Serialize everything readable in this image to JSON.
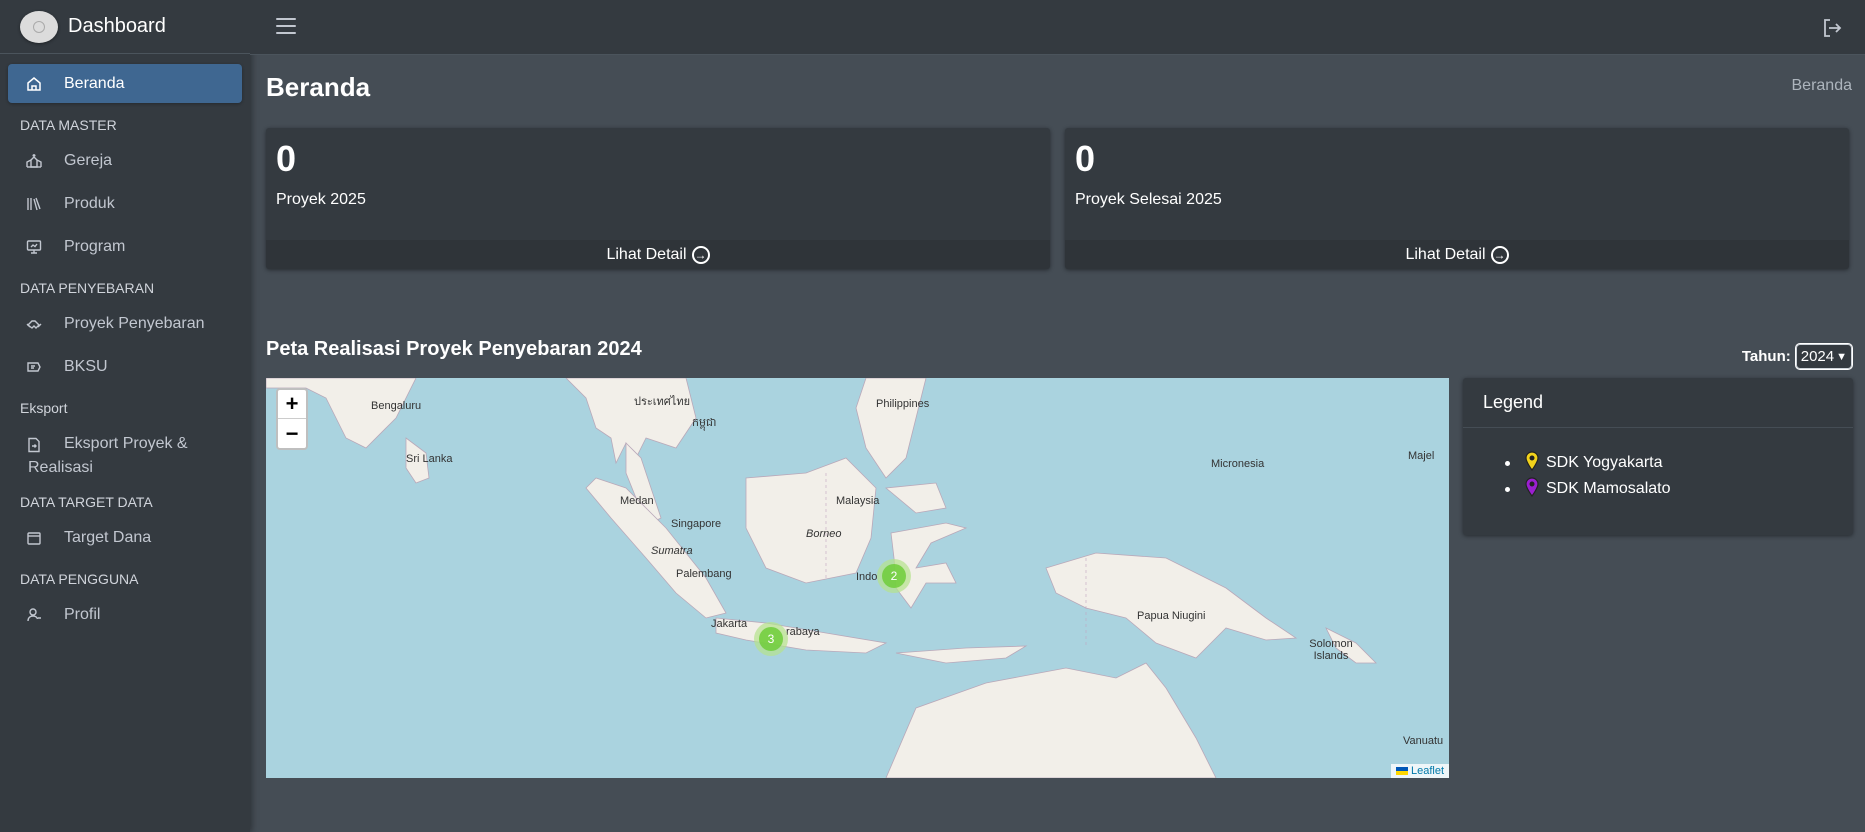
{
  "brand": {
    "title": "Dashboard"
  },
  "sidebar": {
    "items": [
      {
        "type": "item",
        "label": "Beranda",
        "icon": "home-icon",
        "active": true
      },
      {
        "type": "header",
        "label": "DATA MASTER"
      },
      {
        "type": "item",
        "label": "Gereja",
        "icon": "church-icon"
      },
      {
        "type": "item",
        "label": "Produk",
        "icon": "books-icon"
      },
      {
        "type": "item",
        "label": "Program",
        "icon": "presentation-icon"
      },
      {
        "type": "header",
        "label": "DATA PENYEBARAN"
      },
      {
        "type": "item",
        "label": "Proyek Penyebaran",
        "icon": "handshake-icon"
      },
      {
        "type": "item",
        "label": "BKSU",
        "icon": "receipt-icon"
      },
      {
        "type": "header",
        "label": "Eksport"
      },
      {
        "type": "item",
        "label": "Eksport Proyek & Realisasi",
        "icon": "file-export-icon"
      },
      {
        "type": "header",
        "label": "DATA TARGET DATA"
      },
      {
        "type": "item",
        "label": "Target Dana",
        "icon": "wallet-icon"
      },
      {
        "type": "header",
        "label": "DATA PENGGUNA"
      },
      {
        "type": "item",
        "label": "Profil",
        "icon": "user-icon"
      }
    ]
  },
  "page": {
    "title": "Beranda",
    "breadcrumb": "Beranda"
  },
  "stats": [
    {
      "value": "0",
      "label": "Proyek 2025",
      "link": "Lihat Detail"
    },
    {
      "value": "0",
      "label": "Proyek Selesai 2025",
      "link": "Lihat Detail"
    }
  ],
  "map_section": {
    "title": "Peta Realisasi Proyek Penyebaran 2024",
    "year_label": "Tahun:",
    "year_value": "2024",
    "zoom_in": "+",
    "zoom_out": "−",
    "attribution": "Leaflet",
    "clusters": [
      "2",
      "3"
    ],
    "labels": [
      "Bengaluru",
      "Sri Lanka",
      "Medan",
      "Singapore",
      "Sumatra",
      "Palembang",
      "Jakarta",
      "rabaya",
      "Borneo",
      "Malaysia",
      "Indo",
      "Philippines",
      "Micronesia",
      "Papua Niugini",
      "Solomon Islands",
      "Majel",
      "Vanuatu",
      "ประเทศไทย",
      "កម្ពុជា"
    ]
  },
  "legend": {
    "title": "Legend",
    "items": [
      {
        "label": "SDK Yogyakarta",
        "color": "#f2d21b"
      },
      {
        "label": "SDK Mamosalato",
        "color": "#9b1fd1"
      }
    ]
  }
}
